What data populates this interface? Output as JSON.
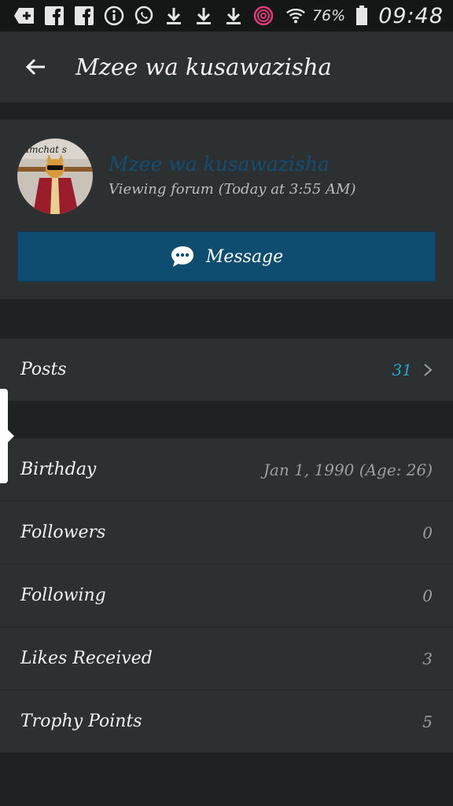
{
  "statusbar": {
    "battery": "76%",
    "time": "09:48",
    "icons": [
      "add-box-icon",
      "facebook-icon",
      "facebook-icon",
      "info-icon",
      "whatsapp-icon",
      "download-icon",
      "download-icon",
      "download-icon",
      "fingerprint-app-icon",
      "wifi-icon",
      "battery-icon"
    ]
  },
  "appbar": {
    "title": "Mzee wa kusawazisha"
  },
  "profile": {
    "username": "Mzee wa kusawazisha",
    "status": "Viewing forum (Today at 3:55 AM)",
    "message_label": "Message",
    "avatar_caption": "amchat s"
  },
  "posts": {
    "label": "Posts",
    "value": "31"
  },
  "details": [
    {
      "label": "Birthday",
      "value": "Jan 1, 1990 (Age: 26)"
    },
    {
      "label": "Followers",
      "value": "0"
    },
    {
      "label": "Following",
      "value": "0"
    },
    {
      "label": "Likes Received",
      "value": "3"
    },
    {
      "label": "Trophy Points",
      "value": "5"
    }
  ],
  "colors": {
    "accent": "#0f4d70",
    "posts_count": "#2aa3d6",
    "background": "#1f2222",
    "card": "#2c3030"
  }
}
